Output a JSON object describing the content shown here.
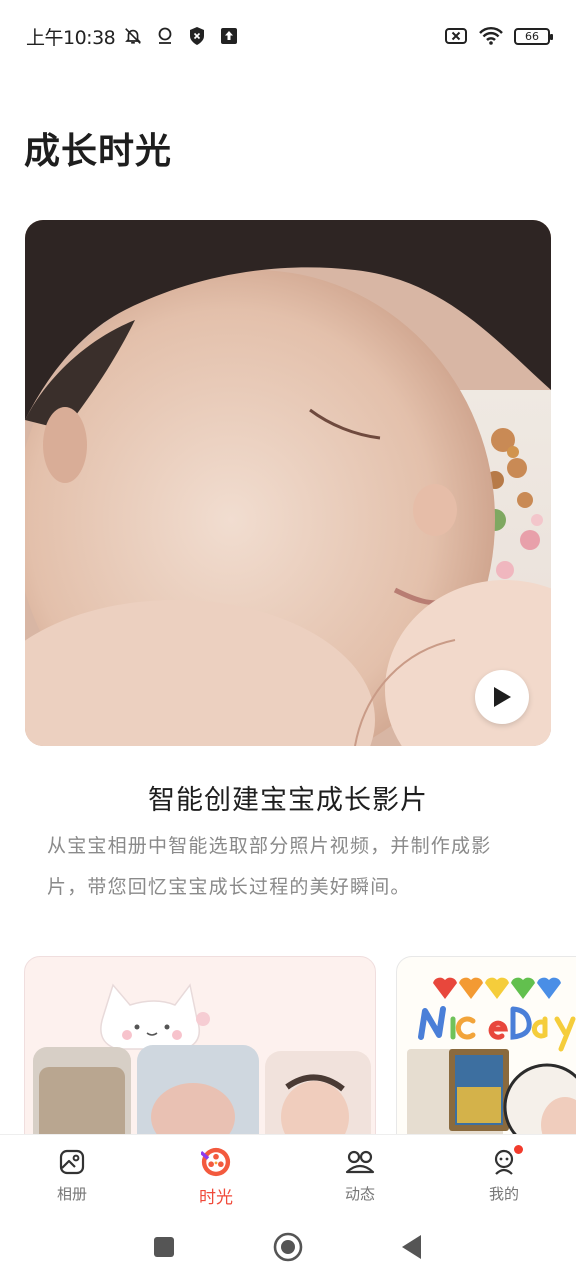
{
  "status_bar": {
    "time": "上午10:38",
    "battery": "66",
    "left_icons": [
      "bell-off-icon",
      "location-icon",
      "shield-icon",
      "upload-icon"
    ],
    "right_icons": [
      "sim-off-icon",
      "wifi-icon",
      "battery-icon"
    ]
  },
  "page": {
    "title": "成长时光"
  },
  "hero": {
    "heading": "智能创建宝宝成长影片",
    "description": "从宝宝相册中智能选取部分照片视频，并制作成影片，带您回忆宝宝成长过程的美好瞬间。"
  },
  "templates": [
    {
      "name": "cute-cat-template"
    },
    {
      "name": "niceday-template",
      "art_text": "NiceDay"
    }
  ],
  "bottom_nav": {
    "items": [
      {
        "label": "相册",
        "icon": "album-icon",
        "active": false
      },
      {
        "label": "时光",
        "icon": "film-reel-icon",
        "active": true
      },
      {
        "label": "动态",
        "icon": "people-icon",
        "active": false
      },
      {
        "label": "我的",
        "icon": "profile-icon",
        "active": false,
        "badge": true
      }
    ]
  },
  "colors": {
    "accent": "#f04a3a",
    "text_secondary": "#8a8a8a"
  }
}
